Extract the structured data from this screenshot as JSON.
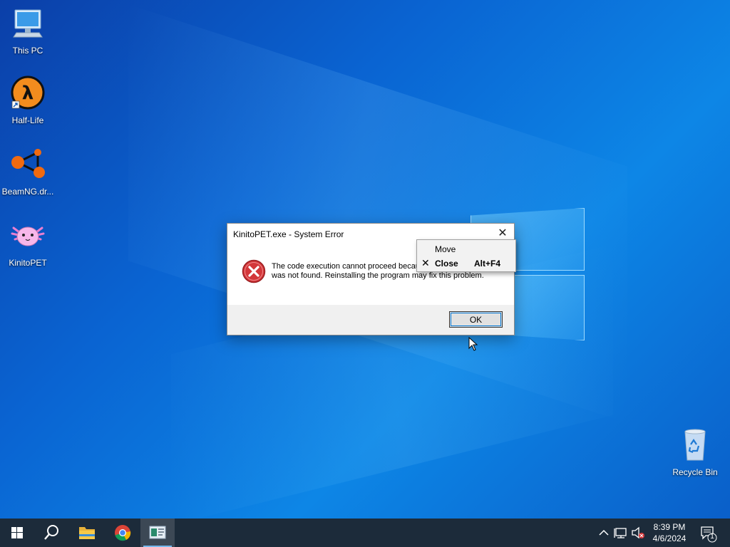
{
  "desktop": {
    "icons": [
      {
        "label": "This PC",
        "icon": "computer-icon"
      },
      {
        "label": "Half-Life",
        "icon": "half-life-icon"
      },
      {
        "label": "BeamNG.dr...",
        "icon": "beamng-icon"
      },
      {
        "label": "KinitoPET",
        "icon": "kinitopet-icon"
      },
      {
        "label": "Recycle Bin",
        "icon": "recycle-bin-icon"
      }
    ]
  },
  "dialog": {
    "title": "KinitoPET.exe - System Error",
    "message": "The code execution cannot proceed because mono-2.0-sgen.dll was not found. Reinstalling the program may fix this problem.",
    "ok_label": "OK"
  },
  "system_menu": {
    "items": [
      {
        "label": "Move",
        "shortcut": ""
      },
      {
        "label": "Close",
        "shortcut": "Alt+F4"
      }
    ]
  },
  "taskbar": {
    "clock_time": "8:39 PM",
    "clock_date": "4/6/2024",
    "notification_count": "1"
  },
  "colors": {
    "taskbar_bg": "#1c2b3a",
    "accent": "#0078d7",
    "error_red": "#d3373a"
  }
}
